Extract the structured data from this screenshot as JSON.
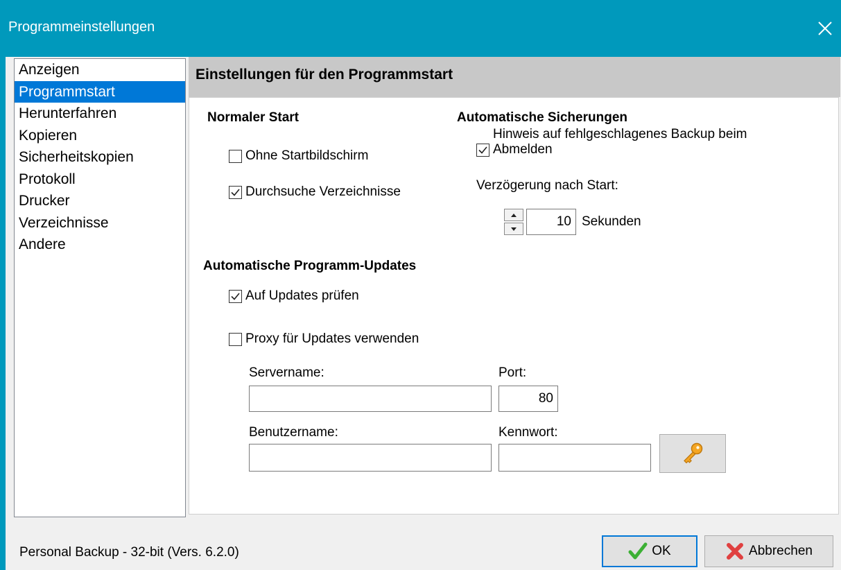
{
  "window": {
    "title": "Programmeinstellungen"
  },
  "nav": {
    "items": [
      {
        "label": "Anzeigen"
      },
      {
        "label": "Programmstart"
      },
      {
        "label": "Herunterfahren"
      },
      {
        "label": "Kopieren"
      },
      {
        "label": "Sicherheitskopien"
      },
      {
        "label": "Protokoll"
      },
      {
        "label": "Drucker"
      },
      {
        "label": "Verzeichnisse"
      },
      {
        "label": "Andere"
      }
    ],
    "selected": "Programmstart"
  },
  "header": {
    "title": "Einstellungen für den Programmstart"
  },
  "normal_start": {
    "title": "Normaler Start",
    "no_splash": {
      "label": "Ohne Startbildschirm",
      "checked": false
    },
    "scan_dirs": {
      "label": "Durchsuche Verzeichnisse",
      "checked": true
    }
  },
  "auto_backup": {
    "title": "Automatische Sicherungen",
    "failed_notice": {
      "label": "Hinweis auf fehlgeschlagenes Backup beim Abmelden",
      "checked": true
    },
    "delay_label": "Verzögerung nach Start:",
    "delay_value": "10",
    "delay_unit": "Sekunden"
  },
  "updates": {
    "title": "Automatische Programm-Updates",
    "check": {
      "label": "Auf Updates prüfen",
      "checked": true
    },
    "proxy": {
      "label": "Proxy für Updates verwenden",
      "checked": false
    },
    "servername_label": "Servername:",
    "servername_value": "",
    "port_label": "Port:",
    "port_value": "80",
    "username_label": "Benutzername:",
    "username_value": "",
    "password_label": "Kennwort:",
    "password_value": ""
  },
  "footer": {
    "status": "Personal Backup - 32-bit (Vers. 6.2.0)",
    "ok_label": "OK",
    "cancel_label": "Abbrechen"
  },
  "colors": {
    "titlebar": "#0099bc",
    "selection": "#0078d7",
    "header": "#c8c8c8",
    "ok_check": "#3cb034",
    "cancel_x": "#e04040",
    "key": "#f0a020"
  },
  "icons": {
    "close": "close-icon",
    "check": "check-icon",
    "key": "key-icon",
    "cancel": "red-x-icon"
  }
}
